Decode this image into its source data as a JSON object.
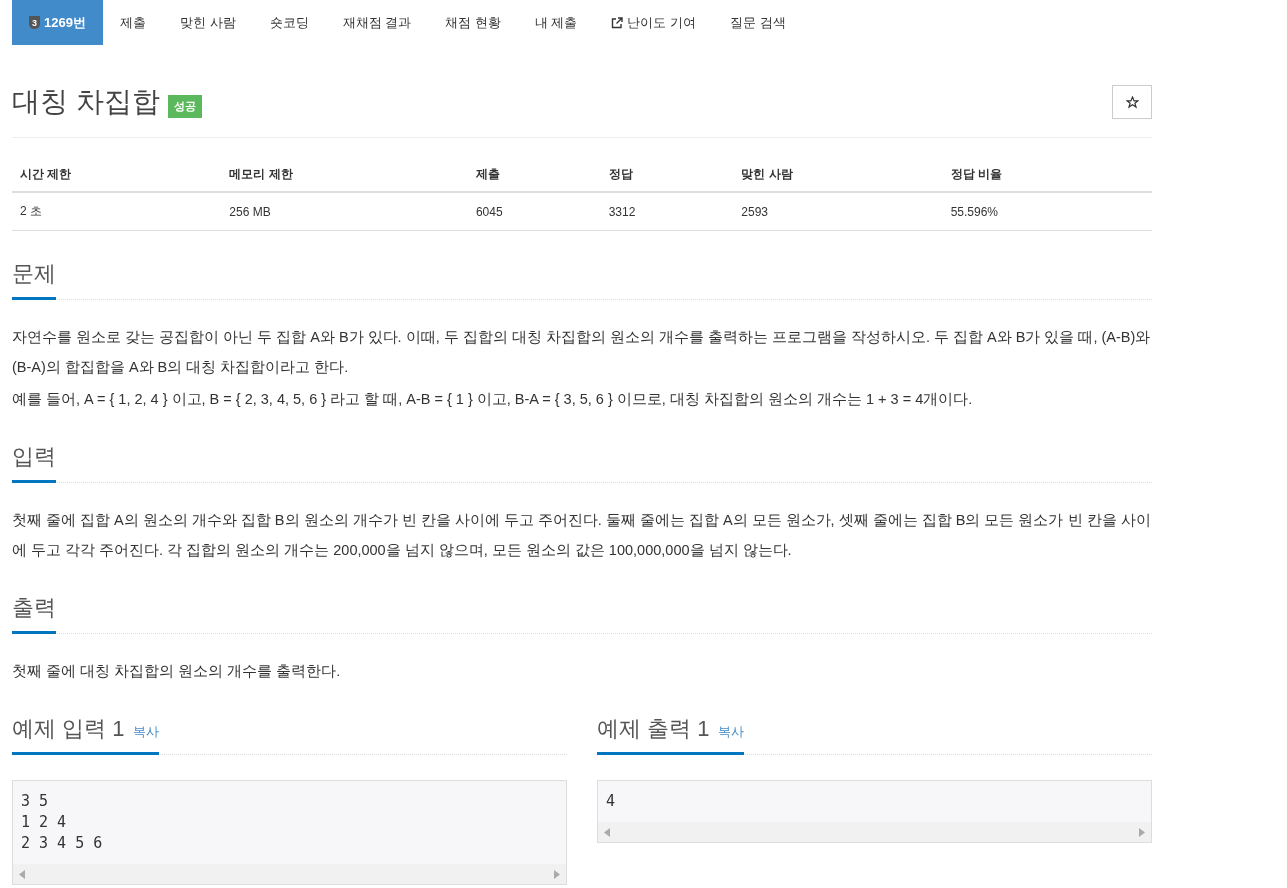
{
  "nav": [
    {
      "badge": "3",
      "label": "1269번",
      "selected": true
    },
    {
      "label": "제출",
      "selected": false
    },
    {
      "label": "맞힌 사람",
      "selected": false
    },
    {
      "label": "숏코딩",
      "selected": false
    },
    {
      "label": "재채점 결과",
      "selected": false
    },
    {
      "label": "채점 현황",
      "selected": false
    },
    {
      "label": "내 제출",
      "selected": false
    },
    {
      "label": "난이도 기여",
      "selected": false,
      "external": true
    },
    {
      "label": "질문 검색",
      "selected": false
    }
  ],
  "title": "대칭 차집합",
  "status_label": "성공",
  "starred": false,
  "info_table": {
    "columns": [
      "시간 제한",
      "메모리 제한",
      "제출",
      "정답",
      "맞힌 사람",
      "정답 비율"
    ],
    "rows": [
      [
        "2 초",
        "256 MB",
        "6045",
        "3312",
        "2593",
        "55.596%"
      ]
    ]
  },
  "sections": [
    {
      "heading": "문제",
      "paragraphs": [
        "자연수를 원소로 갖는 공집합이 아닌 두 집합 A와 B가 있다. 이때, 두 집합의 대칭 차집합의 원소의 개수를 출력하는 프로그램을 작성하시오. 두 집합 A와 B가 있을 때, (A-B)와 (B-A)의 합집합을 A와 B의 대칭 차집합이라고 한다.",
        "예를 들어, A = { 1, 2, 4 } 이고, B = { 2, 3, 4, 5, 6 } 라고 할 때,  A-B = { 1 } 이고, B-A = { 3, 5, 6 } 이므로, 대칭 차집합의 원소의 개수는 1 + 3 = 4개이다."
      ]
    },
    {
      "heading": "입력",
      "paragraphs": [
        "첫째 줄에 집합 A의 원소의 개수와 집합 B의 원소의 개수가 빈 칸을 사이에 두고 주어진다. 둘째 줄에는 집합 A의 모든 원소가, 셋째 줄에는 집합 B의 모든 원소가 빈 칸을 사이에 두고 각각 주어진다. 각 집합의 원소의 개수는 200,000을 넘지 않으며, 모든 원소의 값은 100,000,000을 넘지 않는다."
      ]
    },
    {
      "heading": "출력",
      "paragraphs": [
        "첫째 줄에 대칭 차집합의 원소의 개수를 출력한다."
      ]
    }
  ],
  "samples": [
    {
      "heading": "예제 입력 1",
      "copy": "복사",
      "lines": [
        "3 5",
        "1 2 4",
        "2 3 4 5 6"
      ]
    },
    {
      "heading": "예제 출력 1",
      "copy": "복사",
      "lines": [
        "4"
      ]
    }
  ]
}
